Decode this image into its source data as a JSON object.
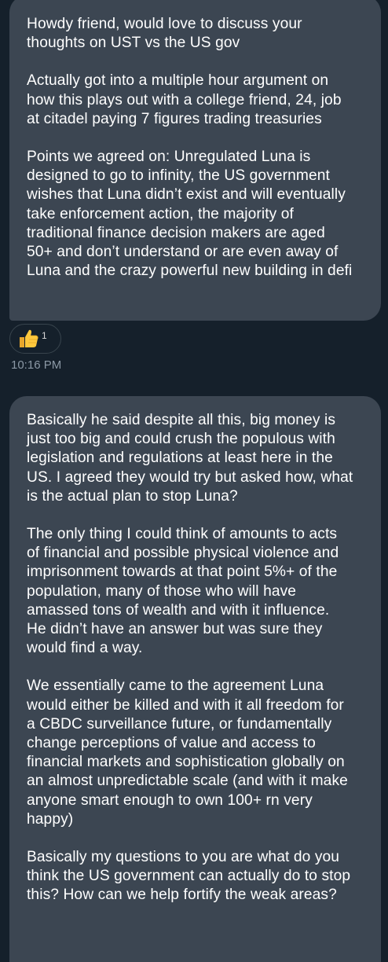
{
  "messages": [
    {
      "paragraphs": [
        "Howdy friend, would love to discuss your\nthoughts on UST vs the US gov",
        "Actually got into a multiple hour argument on\nhow this plays out with a college friend, 24, job\nat citadel paying 7 figures trading treasuries",
        "Points we agreed on: Unregulated Luna is\ndesigned to go to infinity, the US government\nwishes that Luna didn’t exist and will eventually\ntake enforcement action, the majority of\ntraditional finance decision makers are aged\n50+ and don’t understand or are even away of\nLuna and the crazy powerful new building in defi"
      ],
      "reaction": {
        "emoji": "thumbs-up-icon",
        "count": "1"
      },
      "timestamp": "10:16 PM"
    },
    {
      "paragraphs": [
        "Basically he said despite all this, big money is\njust too big and could crush the populous with\nlegislation and regulations at least here in the\nUS. I agreed they would try but asked how, what\nis the actual plan to stop Luna?",
        "The only thing I could think of amounts to acts\nof financial and possible physical violence and\nimprisonment towards at that point 5%+ of the\npopulation, many of those who will have\namassed tons of wealth and with it influence.\nHe didn’t have an answer but was sure they\nwould find a way.",
        "We essentially came to the agreement Luna\nwould either be killed and with it all freedom for\na CBDC surveillance future, or fundamentally\nchange perceptions of value and access to\nfinancial markets and sophistication globally on\nan almost unpredictable scale (and with it make\nanyone smart enough to own 100+ rn very\nhappy)",
        "Basically my questions to you are what do you\nthink the US government can actually do to stop\nthis? How can we help fortify the weak areas?"
      ]
    }
  ],
  "colors": {
    "background": "#15202b",
    "bubble": "#3c4652",
    "timestamp": "#8b98a5"
  }
}
